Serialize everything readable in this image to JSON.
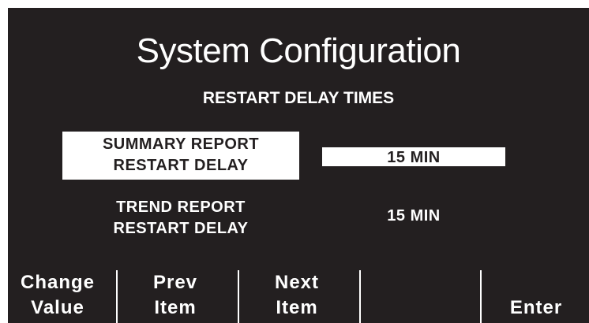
{
  "screen": {
    "title": "System Configuration",
    "subtitle": "RESTART DELAY TIMES"
  },
  "items": [
    {
      "label_line1": "SUMMARY REPORT",
      "label_line2": "RESTART DELAY",
      "value": "15 MIN",
      "selected": true
    },
    {
      "label_line1": "TREND REPORT",
      "label_line2": "RESTART DELAY",
      "value": "15 MIN",
      "selected": false
    }
  ],
  "softkeys": [
    {
      "line1": "Change",
      "line2": "Value"
    },
    {
      "line1": "Prev",
      "line2": "Item"
    },
    {
      "line1": "Next",
      "line2": "Item"
    },
    {
      "line1": "",
      "line2": ""
    },
    {
      "line1": "",
      "line2": "Enter"
    }
  ],
  "colors": {
    "background": "#231f20",
    "foreground": "#ffffff"
  }
}
